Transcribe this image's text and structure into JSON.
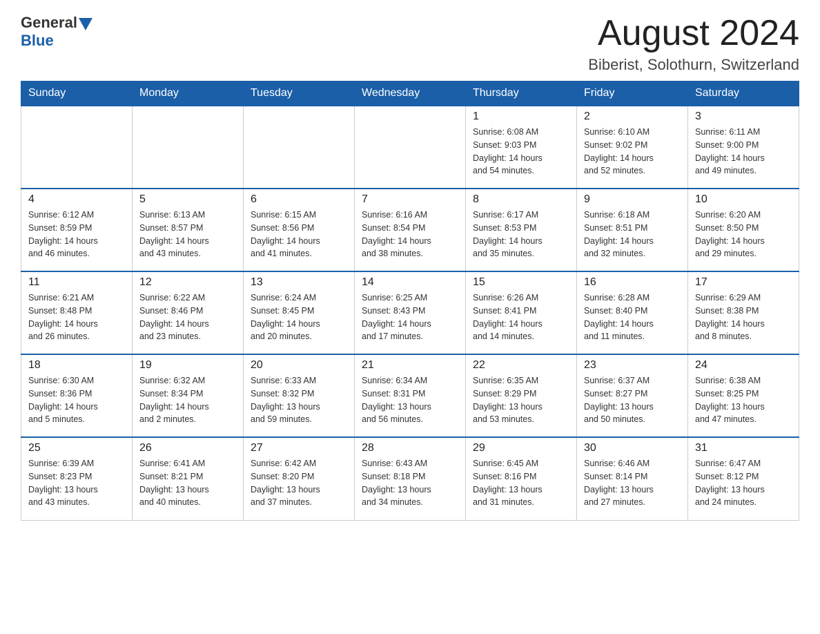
{
  "header": {
    "logo_general": "General",
    "logo_blue": "Blue",
    "month_year": "August 2024",
    "location": "Biberist, Solothurn, Switzerland"
  },
  "days_of_week": [
    "Sunday",
    "Monday",
    "Tuesday",
    "Wednesday",
    "Thursday",
    "Friday",
    "Saturday"
  ],
  "weeks": [
    [
      {
        "day": "",
        "info": ""
      },
      {
        "day": "",
        "info": ""
      },
      {
        "day": "",
        "info": ""
      },
      {
        "day": "",
        "info": ""
      },
      {
        "day": "1",
        "info": "Sunrise: 6:08 AM\nSunset: 9:03 PM\nDaylight: 14 hours\nand 54 minutes."
      },
      {
        "day": "2",
        "info": "Sunrise: 6:10 AM\nSunset: 9:02 PM\nDaylight: 14 hours\nand 52 minutes."
      },
      {
        "day": "3",
        "info": "Sunrise: 6:11 AM\nSunset: 9:00 PM\nDaylight: 14 hours\nand 49 minutes."
      }
    ],
    [
      {
        "day": "4",
        "info": "Sunrise: 6:12 AM\nSunset: 8:59 PM\nDaylight: 14 hours\nand 46 minutes."
      },
      {
        "day": "5",
        "info": "Sunrise: 6:13 AM\nSunset: 8:57 PM\nDaylight: 14 hours\nand 43 minutes."
      },
      {
        "day": "6",
        "info": "Sunrise: 6:15 AM\nSunset: 8:56 PM\nDaylight: 14 hours\nand 41 minutes."
      },
      {
        "day": "7",
        "info": "Sunrise: 6:16 AM\nSunset: 8:54 PM\nDaylight: 14 hours\nand 38 minutes."
      },
      {
        "day": "8",
        "info": "Sunrise: 6:17 AM\nSunset: 8:53 PM\nDaylight: 14 hours\nand 35 minutes."
      },
      {
        "day": "9",
        "info": "Sunrise: 6:18 AM\nSunset: 8:51 PM\nDaylight: 14 hours\nand 32 minutes."
      },
      {
        "day": "10",
        "info": "Sunrise: 6:20 AM\nSunset: 8:50 PM\nDaylight: 14 hours\nand 29 minutes."
      }
    ],
    [
      {
        "day": "11",
        "info": "Sunrise: 6:21 AM\nSunset: 8:48 PM\nDaylight: 14 hours\nand 26 minutes."
      },
      {
        "day": "12",
        "info": "Sunrise: 6:22 AM\nSunset: 8:46 PM\nDaylight: 14 hours\nand 23 minutes."
      },
      {
        "day": "13",
        "info": "Sunrise: 6:24 AM\nSunset: 8:45 PM\nDaylight: 14 hours\nand 20 minutes."
      },
      {
        "day": "14",
        "info": "Sunrise: 6:25 AM\nSunset: 8:43 PM\nDaylight: 14 hours\nand 17 minutes."
      },
      {
        "day": "15",
        "info": "Sunrise: 6:26 AM\nSunset: 8:41 PM\nDaylight: 14 hours\nand 14 minutes."
      },
      {
        "day": "16",
        "info": "Sunrise: 6:28 AM\nSunset: 8:40 PM\nDaylight: 14 hours\nand 11 minutes."
      },
      {
        "day": "17",
        "info": "Sunrise: 6:29 AM\nSunset: 8:38 PM\nDaylight: 14 hours\nand 8 minutes."
      }
    ],
    [
      {
        "day": "18",
        "info": "Sunrise: 6:30 AM\nSunset: 8:36 PM\nDaylight: 14 hours\nand 5 minutes."
      },
      {
        "day": "19",
        "info": "Sunrise: 6:32 AM\nSunset: 8:34 PM\nDaylight: 14 hours\nand 2 minutes."
      },
      {
        "day": "20",
        "info": "Sunrise: 6:33 AM\nSunset: 8:32 PM\nDaylight: 13 hours\nand 59 minutes."
      },
      {
        "day": "21",
        "info": "Sunrise: 6:34 AM\nSunset: 8:31 PM\nDaylight: 13 hours\nand 56 minutes."
      },
      {
        "day": "22",
        "info": "Sunrise: 6:35 AM\nSunset: 8:29 PM\nDaylight: 13 hours\nand 53 minutes."
      },
      {
        "day": "23",
        "info": "Sunrise: 6:37 AM\nSunset: 8:27 PM\nDaylight: 13 hours\nand 50 minutes."
      },
      {
        "day": "24",
        "info": "Sunrise: 6:38 AM\nSunset: 8:25 PM\nDaylight: 13 hours\nand 47 minutes."
      }
    ],
    [
      {
        "day": "25",
        "info": "Sunrise: 6:39 AM\nSunset: 8:23 PM\nDaylight: 13 hours\nand 43 minutes."
      },
      {
        "day": "26",
        "info": "Sunrise: 6:41 AM\nSunset: 8:21 PM\nDaylight: 13 hours\nand 40 minutes."
      },
      {
        "day": "27",
        "info": "Sunrise: 6:42 AM\nSunset: 8:20 PM\nDaylight: 13 hours\nand 37 minutes."
      },
      {
        "day": "28",
        "info": "Sunrise: 6:43 AM\nSunset: 8:18 PM\nDaylight: 13 hours\nand 34 minutes."
      },
      {
        "day": "29",
        "info": "Sunrise: 6:45 AM\nSunset: 8:16 PM\nDaylight: 13 hours\nand 31 minutes."
      },
      {
        "day": "30",
        "info": "Sunrise: 6:46 AM\nSunset: 8:14 PM\nDaylight: 13 hours\nand 27 minutes."
      },
      {
        "day": "31",
        "info": "Sunrise: 6:47 AM\nSunset: 8:12 PM\nDaylight: 13 hours\nand 24 minutes."
      }
    ]
  ]
}
